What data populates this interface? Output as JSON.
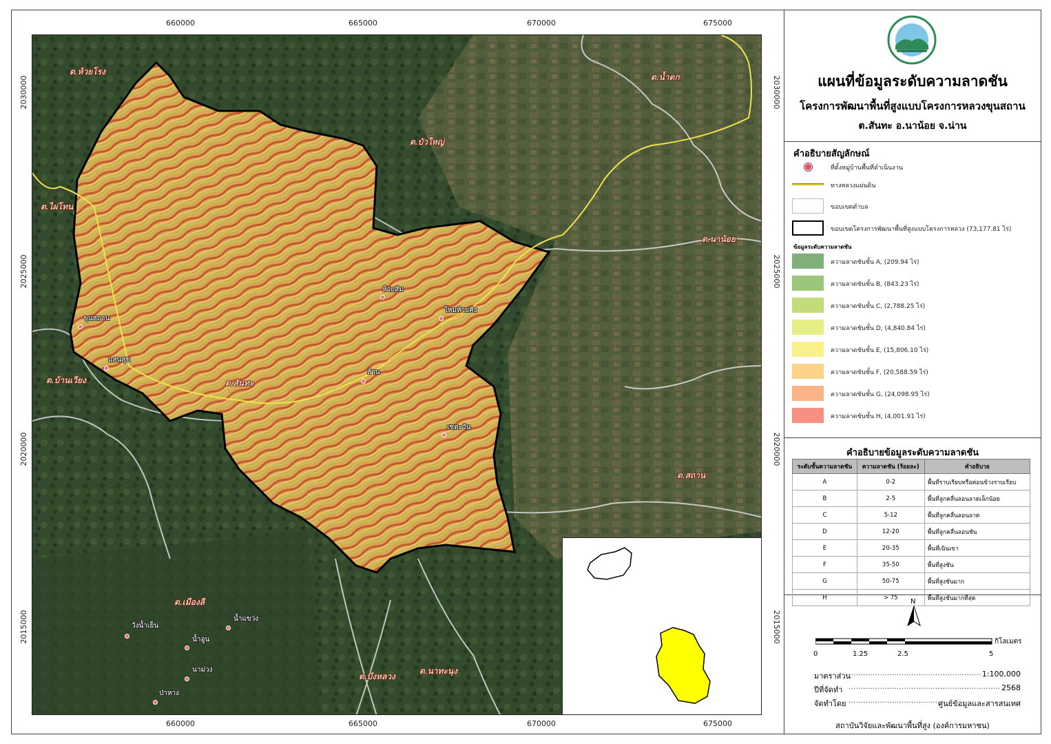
{
  "map": {
    "coords_top": [
      "660000",
      "665000",
      "670000",
      "675000"
    ],
    "coords_bottom": [
      "660000",
      "665000",
      "670000",
      "675000"
    ],
    "coords_left": [
      "2030000",
      "2025000",
      "2020000",
      "2015000"
    ],
    "coords_right": [
      "2030000",
      "2025000",
      "2020000",
      "2015000"
    ],
    "subdistricts": [
      {
        "name": "ต.ห้วยโรง"
      },
      {
        "name": "ต.น้ำตก"
      },
      {
        "name": "ต.บัวใหญ่"
      },
      {
        "name": "ต.ไผ่โทน"
      },
      {
        "name": "ต.นาน้อย"
      },
      {
        "name": "ต.บ้านเวียง"
      },
      {
        "name": "ต.สันทะ"
      },
      {
        "name": "ต.สถาน"
      },
      {
        "name": "ต.เมืองลี"
      },
      {
        "name": "ต.บึงหลวง"
      },
      {
        "name": "ต.นาทะนุง"
      }
    ],
    "villages": [
      {
        "name": "ห้วยส้ม"
      },
      {
        "name": "ใหม่ห้วยคิง"
      },
      {
        "name": "ขุนสถาน"
      },
      {
        "name": "แสนสุข"
      },
      {
        "name": "ส้าน"
      },
      {
        "name": "เชตะวัน"
      },
      {
        "name": "วังน้ำเย็น"
      },
      {
        "name": "น้ำแขว่ง"
      },
      {
        "name": "น้ำอูน"
      },
      {
        "name": "นาม่วง"
      },
      {
        "name": "ป่าหาง"
      }
    ]
  },
  "title": {
    "line1": "แผนที่ข้อมูลระดับความลาดชัน",
    "line2": "โครงการพัฒนาพื้นที่สูงแบบโครงการหลวงขุนสถาน",
    "line3": "ต.สันทะ อ.นาน้อย จ.น่าน"
  },
  "legend": {
    "title": "คำอธิบายสัญลักษณ์",
    "items": [
      {
        "label": "ที่ตั้งหมู่บ้านพื้นที่ดำเนินงาน"
      },
      {
        "label": "ทางหลวงแผ่นดิน"
      },
      {
        "label": "ขอบเขตตำบล"
      },
      {
        "label": "ขอบเขตโครงการพัฒนาพื้นที่สูงแบบโครงการหลวง (73,177.81 ไร่)"
      }
    ],
    "slope_title": "ข้อมูลระดับความลาดชัน",
    "slope_classes": [
      {
        "label": "ความลาดชันชั้น  A, (209.94 ไร่)",
        "color": "#7fb07a"
      },
      {
        "label": "ความลาดชันชั้น  B, (843.23 ไร่)",
        "color": "#9cc67a"
      },
      {
        "label": "ความลาดชันชั้น  C, (2,788.25 ไร่)",
        "color": "#c2dc7c"
      },
      {
        "label": "ความลาดชันชั้น  D, (4,840.84 ไร่)",
        "color": "#e6ee88"
      },
      {
        "label": "ความลาดชันชั้น  E, (15,806.10 ไร่)",
        "color": "#fbf18a"
      },
      {
        "label": "ความลาดชันชั้น  F, (20,588.59 ไร่)",
        "color": "#fcd38a"
      },
      {
        "label": "ความลาดชันชั้น  G, (24,098.95 ไร่)",
        "color": "#fbb385"
      },
      {
        "label": "ความลาดชันชั้น  H, (4,001.91 ไร่)",
        "color": "#f78f82"
      }
    ]
  },
  "slope_table": {
    "title": "คำอธิบายข้อมูลระดับความลาดชัน",
    "headers": [
      "ระดับชั้นความลาดชัน",
      "ความลาดชัน (ร้อยละ)",
      "คำอธิบาย"
    ],
    "rows": [
      [
        "A",
        "0-2",
        "พื้นที่ราบเรียบหรือค่อนข้างราบเรียบ"
      ],
      [
        "B",
        "2-5",
        "พื้นที่ลูกคลื่นลอนลาดเล็กน้อย"
      ],
      [
        "C",
        "5-12",
        "พื้นที่ลูกคลื่นลอนลาด"
      ],
      [
        "D",
        "12-20",
        "พื้นที่ลูกคลื่นลอนชัน"
      ],
      [
        "E",
        "20-35",
        "พื้นที่เนินเขา"
      ],
      [
        "F",
        "35-50",
        "พื้นที่สูงชัน"
      ],
      [
        "G",
        "50-75",
        "พื้นที่สูงชันมาก"
      ],
      [
        "H",
        "> 75",
        "พื้นที่สูงชันมากที่สุด"
      ]
    ]
  },
  "scale": {
    "north": "N",
    "labels": [
      "0",
      "1.25",
      "2.5",
      "5"
    ],
    "unit": "กิโลเมตร"
  },
  "info": {
    "scale_label": "มาตราส่วน",
    "scale_value": "1:100,000",
    "year_label": "ปีที่จัดทำ",
    "year_value": "2568",
    "by_label": "จัดทำโดย",
    "by_value": "ศูนย์ข้อมูลและสารสนเทศ",
    "footer": "สถาบันวิจัยและพัฒนาพื้นที่สูง (องค์การมหาชน)"
  }
}
